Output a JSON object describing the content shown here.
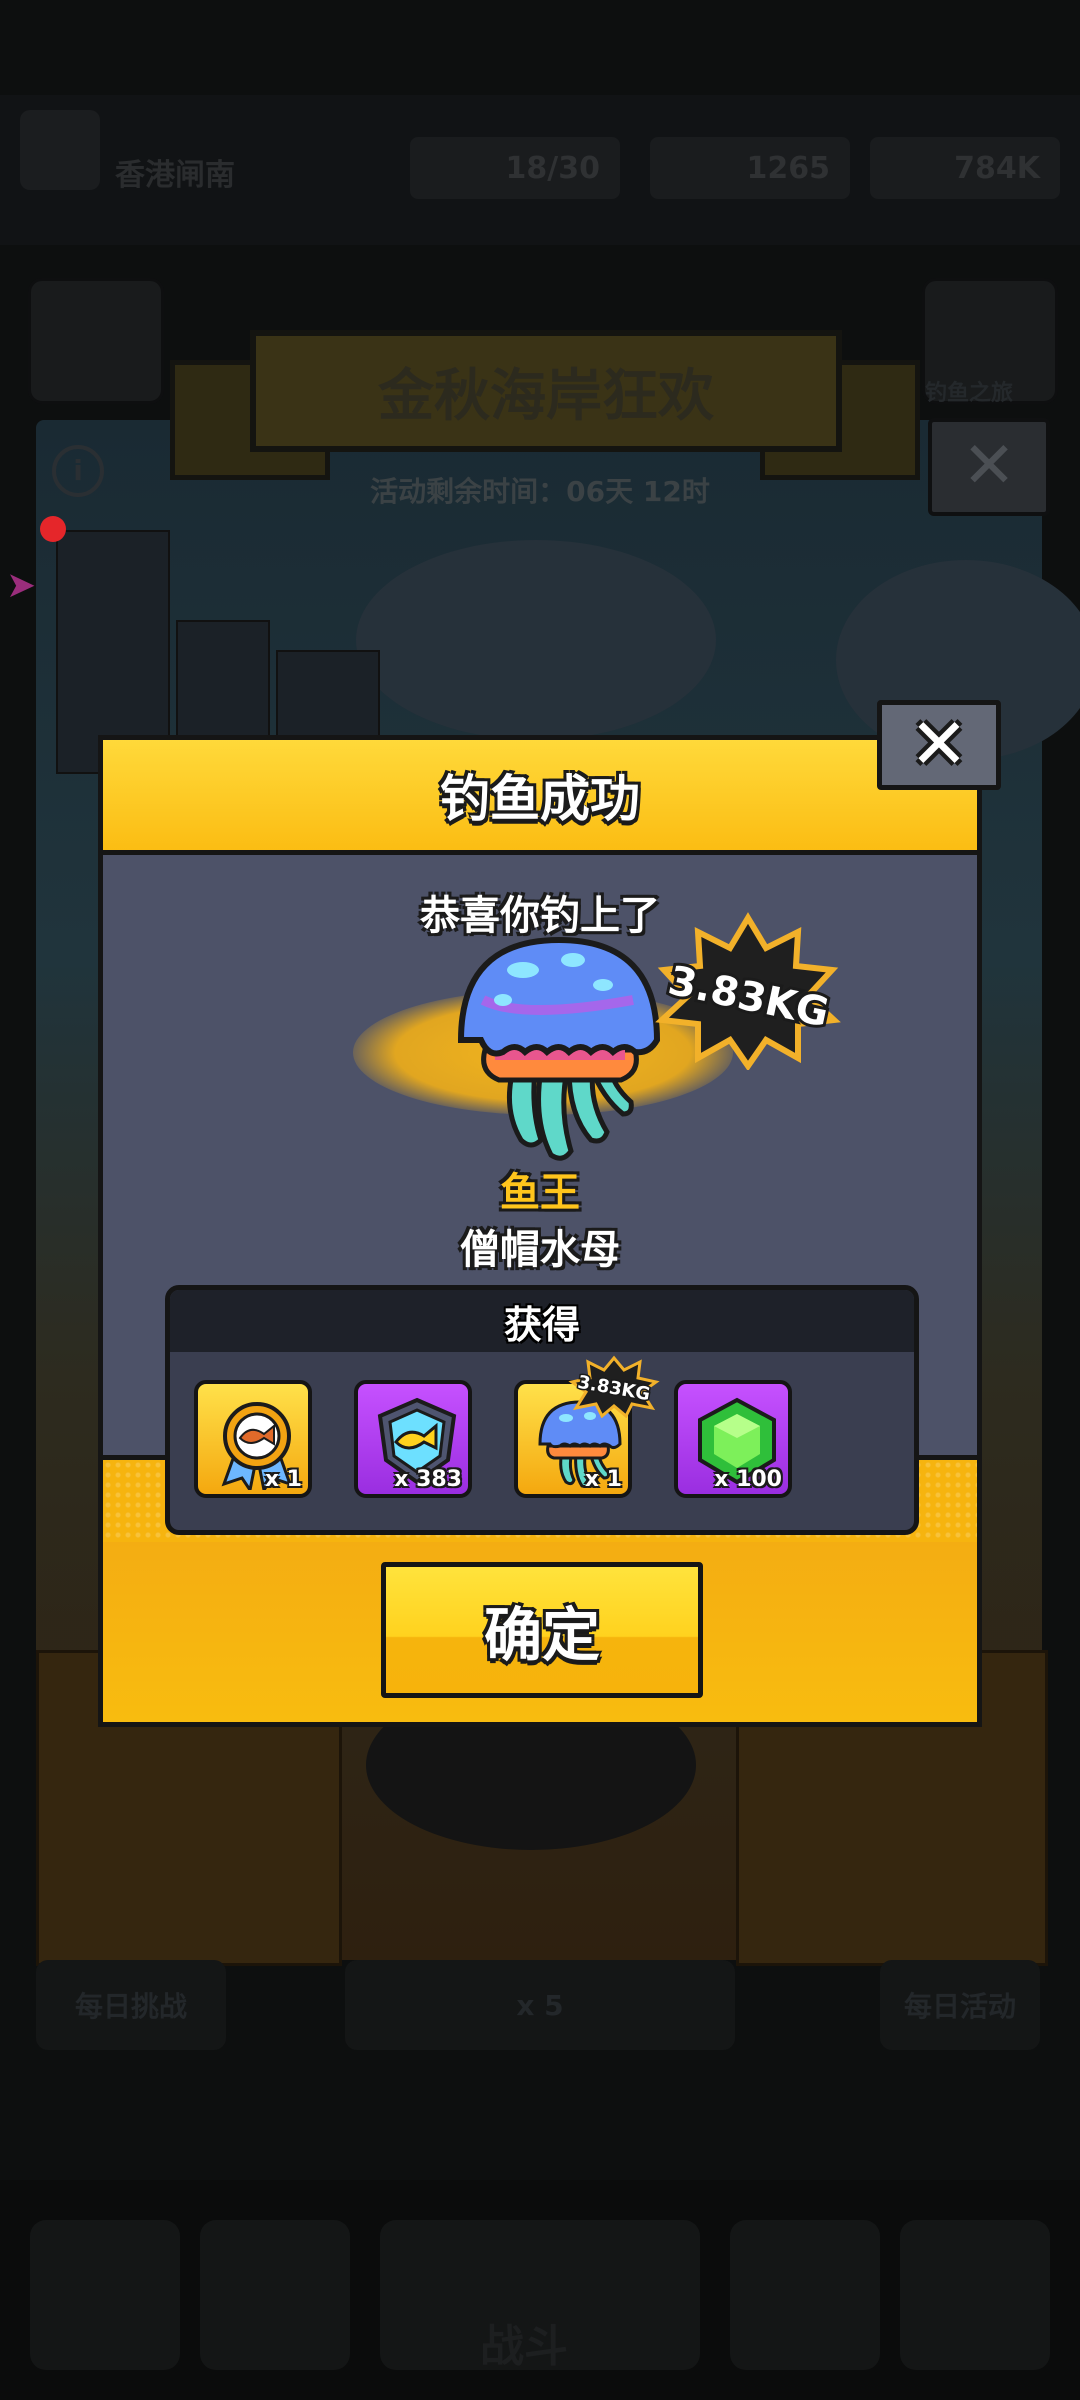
{
  "background": {
    "player_name": "香港闸南",
    "stats": [
      {
        "icon": "level-icon",
        "value": "18/30"
      },
      {
        "icon": "fish-icon",
        "value": "1265"
      },
      {
        "icon": "coin-icon",
        "value": "784K"
      }
    ],
    "event_title": "金秋海岸狂欢",
    "event_timer": "活动剩余时间：06天 12时",
    "side_label": "钓鱼之旅",
    "bottom_left_button": "每日挑战",
    "bottom_center_button": "x 5",
    "bottom_right_button": "每日活动",
    "nav_center_label": "战斗"
  },
  "dialog": {
    "title": "钓鱼成功",
    "close_symbol": "✕",
    "congrats": "恭喜你钓上了",
    "weight": "3.83KG",
    "rank": "鱼王",
    "fish_name": "僧帽水母",
    "rewards_title": "获得",
    "rewards": [
      {
        "icon": "fish-medal-icon",
        "count": "x 1",
        "style": "gold"
      },
      {
        "icon": "fish-badge-icon",
        "count": "x 383",
        "style": "purple"
      },
      {
        "icon": "jellyfish-icon",
        "count": "x 1",
        "style": "gold",
        "tag": "3.83KG"
      },
      {
        "icon": "green-gem-icon",
        "count": "x 100",
        "style": "purple"
      }
    ],
    "confirm_label": "确定"
  }
}
